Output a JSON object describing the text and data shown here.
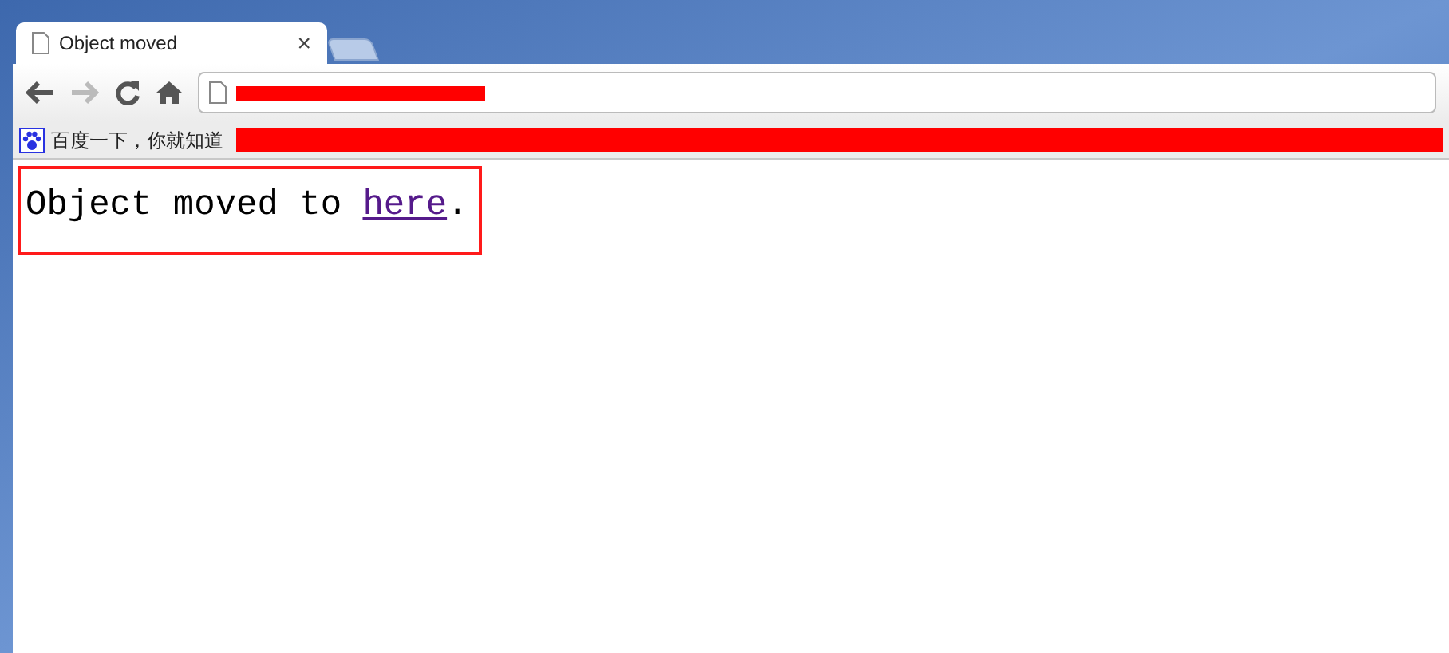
{
  "tabs": [
    {
      "title": "Object moved",
      "close": "×",
      "kind": "page",
      "selected": true
    },
    {
      "kind": "new"
    }
  ],
  "address_bar": {
    "redacted": true
  },
  "bookmarks_bar": {
    "items": [
      {
        "label": "百度一下，你就知道"
      }
    ],
    "redacted": true
  },
  "page": {
    "text_before": "Object moved to ",
    "link": "here",
    "text_after": ".",
    "highlighted": true
  }
}
